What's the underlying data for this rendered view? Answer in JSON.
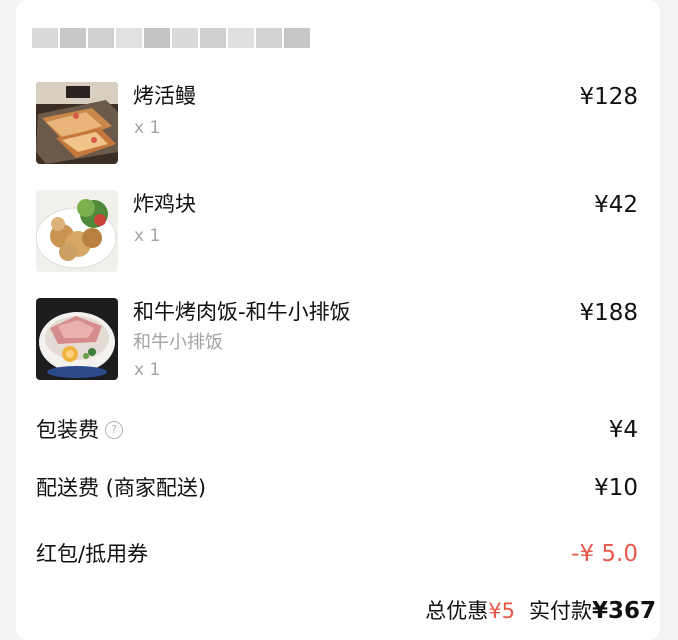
{
  "store": {
    "name_blur_colors": [
      "#d9d9d9",
      "#c8c8c8",
      "#d0d0d0",
      "#e1e1e1",
      "#c4c4c4",
      "#dadada",
      "#cfcfcf",
      "#e0e0e0",
      "#d3d3d3",
      "#c6c6c6"
    ]
  },
  "items": [
    {
      "name": "烤活鳗",
      "variant": "",
      "qty": "x 1",
      "price": "¥128"
    },
    {
      "name": "炸鸡块",
      "variant": "",
      "qty": "x 1",
      "price": "¥42"
    },
    {
      "name": "和牛烤肉饭-和牛小排饭",
      "variant": "和牛小排饭",
      "qty": "x 1",
      "price": "¥188"
    }
  ],
  "fees": {
    "packaging": {
      "label": "包装费",
      "value": "¥4",
      "help_icon": "question-circle-icon"
    },
    "delivery": {
      "label": "配送费 (商家配送)",
      "value": "¥10"
    },
    "coupon": {
      "label": "红包/抵用券",
      "value": "-¥ 5.0"
    }
  },
  "summary": {
    "discount_label": "总优惠",
    "discount_value": "¥5",
    "paid_label": "实付款",
    "paid_value": "¥367"
  },
  "colors": {
    "accent_red": "#e8584a",
    "muted_text": "#a4a4a4",
    "primary_text": "#111111"
  }
}
